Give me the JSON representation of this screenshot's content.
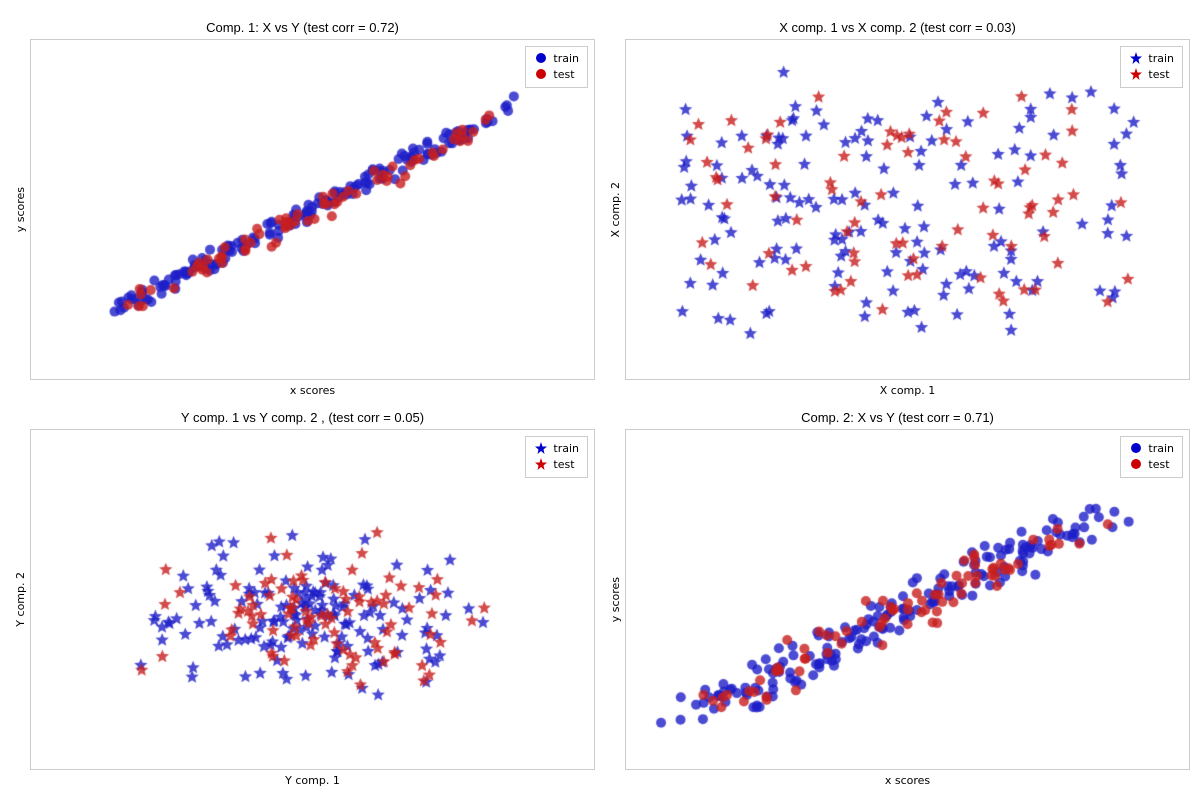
{
  "plots": [
    {
      "id": "plot1",
      "title": "Comp. 1: X vs Y (test corr = 0.72)",
      "xlabel": "x scores",
      "ylabel": "y scores",
      "legend_type": "circle",
      "data": {
        "train_color": "#0000cc",
        "test_color": "#cc0000"
      }
    },
    {
      "id": "plot2",
      "title": "X comp. 1 vs X comp. 2 (test corr = 0.03)",
      "xlabel": "X comp. 1",
      "ylabel": "X comp. 2",
      "legend_type": "star",
      "data": {
        "train_color": "#0000cc",
        "test_color": "#cc0000"
      }
    },
    {
      "id": "plot3",
      "title": "Y comp. 1 vs Y comp. 2 , (test corr = 0.05)",
      "xlabel": "Y comp. 1",
      "ylabel": "Y comp. 2",
      "legend_type": "star",
      "data": {
        "train_color": "#0000cc",
        "test_color": "#cc0000"
      }
    },
    {
      "id": "plot4",
      "title": "Comp. 2: X vs Y (test corr = 0.71)",
      "xlabel": "x scores",
      "ylabel": "y scores",
      "legend_type": "circle",
      "data": {
        "train_color": "#0000cc",
        "test_color": "#cc0000"
      }
    }
  ],
  "legend": {
    "train_label": "train",
    "test_label": "test"
  }
}
